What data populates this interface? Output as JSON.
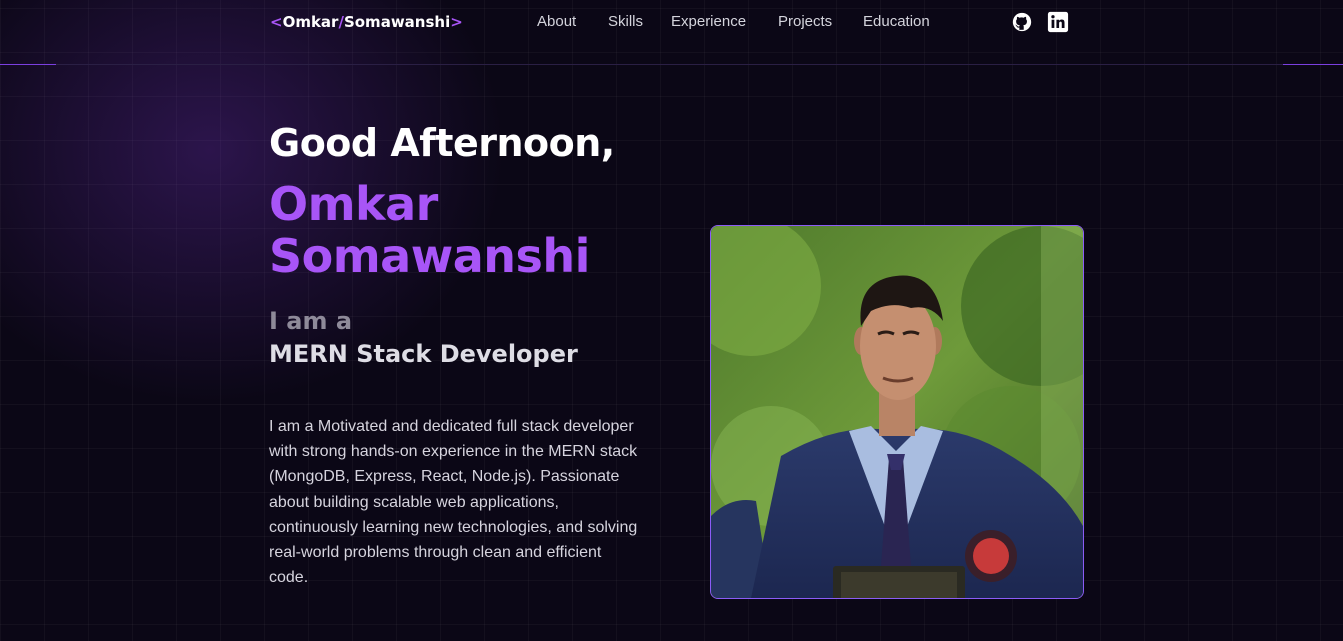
{
  "nav": {
    "logo": {
      "open": "<",
      "first": "Omkar",
      "slash": "/",
      "last": "Somawanshi",
      "close": ">"
    },
    "links": [
      {
        "label": "About"
      },
      {
        "label": "Skills"
      },
      {
        "label": "Experience"
      },
      {
        "label": "Projects"
      },
      {
        "label": "Education"
      }
    ],
    "social": [
      {
        "icon": "github-icon"
      },
      {
        "icon": "linkedin-icon"
      }
    ]
  },
  "hero": {
    "greeting": "Good Afternoon,",
    "name": "Omkar Somawanshi",
    "iam": "I am a",
    "role": "MERN Stack Developer",
    "bio": "I am a Motivated and dedicated full stack developer with strong hands-on experience in the MERN stack (MongoDB, Express, React, Node.js). Passionate about building scalable web applications, continuously learning new technologies, and solving real-world problems through clean and efficient code."
  },
  "colors": {
    "accent": "#a855f7",
    "background": "#0b0716",
    "frame_border": "#8b5cf6"
  }
}
